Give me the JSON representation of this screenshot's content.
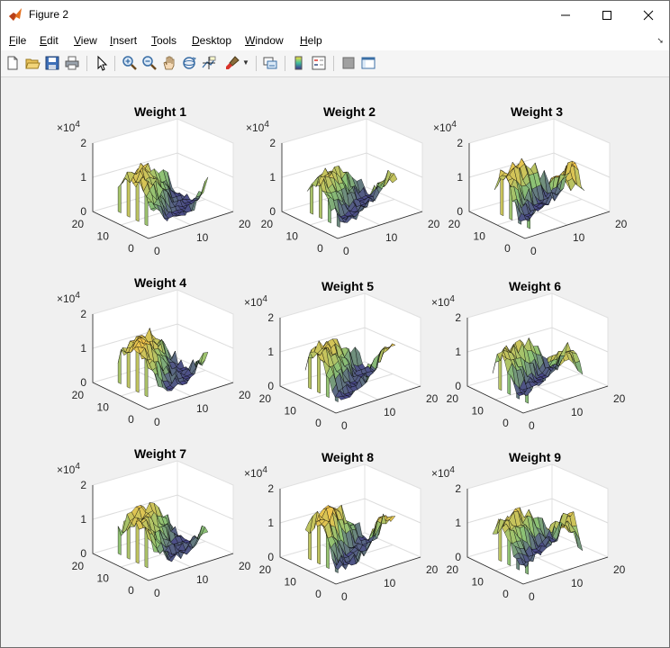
{
  "window": {
    "title": "Figure 2"
  },
  "window_controls": {
    "minimize": "—",
    "maximize": "☐",
    "close": "✕"
  },
  "menu": [
    {
      "first": "F",
      "rest": "ile"
    },
    {
      "first": "E",
      "rest": "dit"
    },
    {
      "first": "V",
      "rest": "iew"
    },
    {
      "first": "I",
      "rest": "nsert"
    },
    {
      "first": "T",
      "rest": "ools"
    },
    {
      "first": "D",
      "rest": "esktop"
    },
    {
      "first": "W",
      "rest": "indow"
    },
    {
      "first": "H",
      "rest": "elp"
    }
  ],
  "toolbar": [
    "new-figure-icon",
    "open-file-icon",
    "save-icon",
    "print-icon",
    "edit-plot-icon",
    "zoom-in-icon",
    "zoom-out-icon",
    "pan-icon",
    "rotate-3d-icon",
    "data-cursor-icon",
    "brush-icon",
    "link-plot-icon",
    "colorbar-icon",
    "legend-icon",
    "hide-plot-tools-icon",
    "show-plot-tools-icon"
  ],
  "colors": {
    "surface_low": "#3b2f8c",
    "surface_mid": "#8cc275",
    "surface_high": "#f4c54a",
    "accent_orange": "#f5a623",
    "axis_text": "#262626",
    "grid": "#dcdcdc"
  },
  "chart_data": [
    {
      "type": "surface",
      "title": "Weight 1",
      "zlim": [
        0,
        2
      ],
      "z_ticks": [
        "0",
        "1",
        "2"
      ],
      "z_multiplier": "×10^4",
      "x_ticks": [
        "0",
        "10",
        "20"
      ],
      "y_ticks": [
        "0",
        "10",
        "20"
      ],
      "colormap": "parula",
      "z_peak_approx": 1.2
    },
    {
      "type": "surface",
      "title": "Weight 2",
      "zlim": [
        0,
        2
      ],
      "z_ticks": [
        "0",
        "1",
        "2"
      ],
      "z_multiplier": "×10^4",
      "x_ticks": [
        "0",
        "10",
        "20"
      ],
      "y_ticks": [
        "0",
        "10",
        "20"
      ],
      "colormap": "parula",
      "z_peak_approx": 1.1
    },
    {
      "type": "surface",
      "title": "Weight 3",
      "zlim": [
        0,
        2
      ],
      "z_ticks": [
        "0",
        "1",
        "2"
      ],
      "z_multiplier": "×10^4",
      "x_ticks": [
        "0",
        "10",
        "20"
      ],
      "y_ticks": [
        "0",
        "10",
        "20"
      ],
      "colormap": "parula",
      "z_peak_approx": 1.3
    },
    {
      "type": "surface",
      "title": "Weight 4",
      "zlim": [
        0,
        2
      ],
      "z_ticks": [
        "0",
        "1",
        "2"
      ],
      "z_multiplier": "×10^4",
      "x_ticks": [
        "0",
        "10",
        "20"
      ],
      "y_ticks": [
        "0",
        "10",
        "20"
      ],
      "colormap": "parula",
      "z_peak_approx": 1.3
    },
    {
      "type": "surface",
      "title": "Weight 5",
      "zlim": [
        0,
        2
      ],
      "z_ticks": [
        "0",
        "1",
        "2"
      ],
      "z_multiplier": "×10^4",
      "x_ticks": [
        "0",
        "10",
        "20"
      ],
      "y_ticks": [
        "0",
        "10",
        "20"
      ],
      "colormap": "parula",
      "z_peak_approx": 1.2
    },
    {
      "type": "surface",
      "title": "Weight 6",
      "zlim": [
        0,
        2
      ],
      "z_ticks": [
        "0",
        "1",
        "2"
      ],
      "z_multiplier": "×10^4",
      "x_ticks": [
        "0",
        "10",
        "20"
      ],
      "y_ticks": [
        "0",
        "10",
        "20"
      ],
      "colormap": "parula",
      "z_peak_approx": 1.1
    },
    {
      "type": "surface",
      "title": "Weight 7",
      "zlim": [
        0,
        2
      ],
      "z_ticks": [
        "0",
        "1",
        "2"
      ],
      "z_multiplier": "×10^4",
      "x_ticks": [
        "0",
        "10",
        "20"
      ],
      "y_ticks": [
        "0",
        "10",
        "20"
      ],
      "colormap": "parula",
      "z_peak_approx": 1.2
    },
    {
      "type": "surface",
      "title": "Weight 8",
      "zlim": [
        0,
        2
      ],
      "z_ticks": [
        "0",
        "1",
        "2"
      ],
      "z_multiplier": "×10^4",
      "x_ticks": [
        "0",
        "10",
        "20"
      ],
      "y_ticks": [
        "0",
        "10",
        "20"
      ],
      "colormap": "parula",
      "z_peak_approx": 1.3
    },
    {
      "type": "surface",
      "title": "Weight 9",
      "zlim": [
        0,
        2
      ],
      "z_ticks": [
        "0",
        "1",
        "2"
      ],
      "z_multiplier": "×10^4",
      "x_ticks": [
        "0",
        "10",
        "20"
      ],
      "y_ticks": [
        "0",
        "10",
        "20"
      ],
      "colormap": "parula",
      "z_peak_approx": 1.2
    }
  ]
}
